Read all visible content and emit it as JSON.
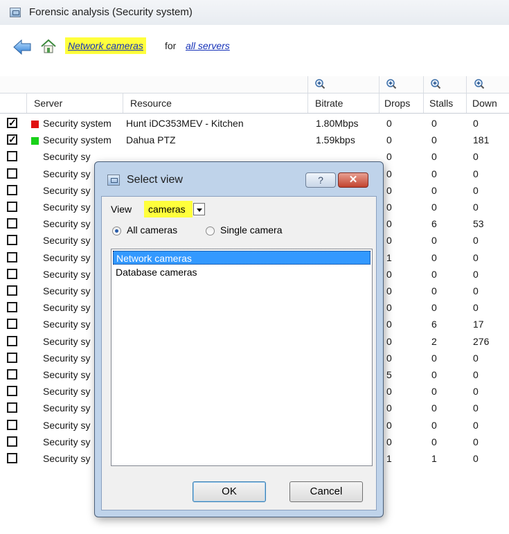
{
  "window": {
    "title": "Forensic analysis (Security system)"
  },
  "nav": {
    "current_view": "Network cameras",
    "for_text": "for",
    "scope": "all servers"
  },
  "columns": [
    "Server",
    "Resource",
    "Bitrate",
    "Drops",
    "Stalls",
    "Down"
  ],
  "rows": [
    {
      "checked": true,
      "status": "#e01010",
      "server": "Security system",
      "resource": "Hunt iDC353MEV - Kitchen",
      "bitrate": "1.80Mbps",
      "drops": "0",
      "stalls": "0",
      "down": "0"
    },
    {
      "checked": true,
      "status": "#19d119",
      "server": "Security system",
      "resource": "Dahua PTZ",
      "bitrate": "1.59kbps",
      "drops": "0",
      "stalls": "0",
      "down": "181"
    },
    {
      "checked": false,
      "server": "Security sy",
      "drops": "0",
      "stalls": "0",
      "down": "0"
    },
    {
      "checked": false,
      "server": "Security sy",
      "drops": "0",
      "stalls": "0",
      "down": "0"
    },
    {
      "checked": false,
      "server": "Security sy",
      "drops": "0",
      "stalls": "0",
      "down": "0"
    },
    {
      "checked": false,
      "server": "Security sy",
      "drops": "0",
      "stalls": "0",
      "down": "0"
    },
    {
      "checked": false,
      "server": "Security sy",
      "drops": "0",
      "stalls": "6",
      "down": "53"
    },
    {
      "checked": false,
      "server": "Security sy",
      "drops": "0",
      "stalls": "0",
      "down": "0"
    },
    {
      "checked": false,
      "server": "Security sy",
      "drops": "1",
      "stalls": "0",
      "down": "0"
    },
    {
      "checked": false,
      "server": "Security sy",
      "drops": "0",
      "stalls": "0",
      "down": "0"
    },
    {
      "checked": false,
      "server": "Security sy",
      "drops": "0",
      "stalls": "0",
      "down": "0"
    },
    {
      "checked": false,
      "server": "Security sy",
      "drops": "0",
      "stalls": "0",
      "down": "0"
    },
    {
      "checked": false,
      "server": "Security sy",
      "drops": "0",
      "stalls": "6",
      "down": "17"
    },
    {
      "checked": false,
      "server": "Security sy",
      "drops": "0",
      "stalls": "2",
      "down": "276"
    },
    {
      "checked": false,
      "server": "Security sy",
      "drops": "0",
      "stalls": "0",
      "down": "0"
    },
    {
      "checked": false,
      "server": "Security sy",
      "drops": "5",
      "stalls": "0",
      "down": "0"
    },
    {
      "checked": false,
      "server": "Security sy",
      "drops": "0",
      "stalls": "0",
      "down": "0"
    },
    {
      "checked": false,
      "server": "Security sy",
      "drops": "0",
      "stalls": "0",
      "down": "0"
    },
    {
      "checked": false,
      "server": "Security sy",
      "drops": "0",
      "stalls": "0",
      "down": "0"
    },
    {
      "checked": false,
      "server": "Security sy",
      "drops": "0",
      "stalls": "0",
      "down": "0"
    },
    {
      "checked": false,
      "server": "Security sy",
      "drops": "1",
      "stalls": "1",
      "down": "0"
    }
  ],
  "dialog": {
    "title": "Select view",
    "help_label": "?",
    "close_label": "✕",
    "view_label": "View",
    "view_value": "cameras",
    "radio_all": "All cameras",
    "radio_single": "Single camera",
    "items": [
      "Network cameras",
      "Database cameras"
    ],
    "ok_label": "OK",
    "cancel_label": "Cancel"
  }
}
